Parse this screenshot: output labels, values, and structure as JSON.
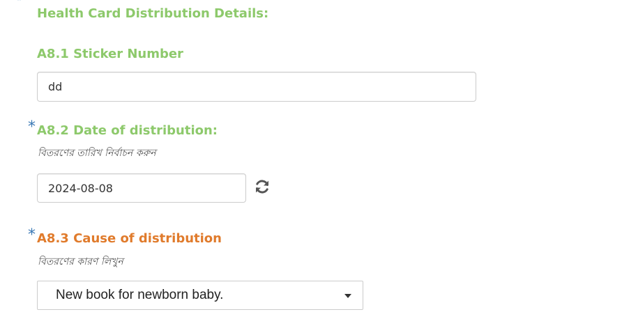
{
  "section": {
    "title": "Health Card Distribution Details:",
    "star": "*"
  },
  "q_a81": {
    "label": "A8.1 Sticker Number",
    "value": "dd"
  },
  "q_a82": {
    "star": "*",
    "label": "A8.2 Date of distribution:",
    "hint": "বিতরণের তারিখ নির্বাচন করুন",
    "value": "2024-08-08",
    "refresh_icon": "refresh-icon"
  },
  "q_a83": {
    "star": "*",
    "label": "A8.3 Cause of distribution",
    "hint": "বিতরণের কারণ লিখুন",
    "selected": "New book for newborn baby.",
    "dropdown_icon": "chevron-down-icon"
  },
  "colors": {
    "label_green": "#8dc96b",
    "label_orange": "#e07b2c",
    "required_star": "#3a78b5"
  }
}
